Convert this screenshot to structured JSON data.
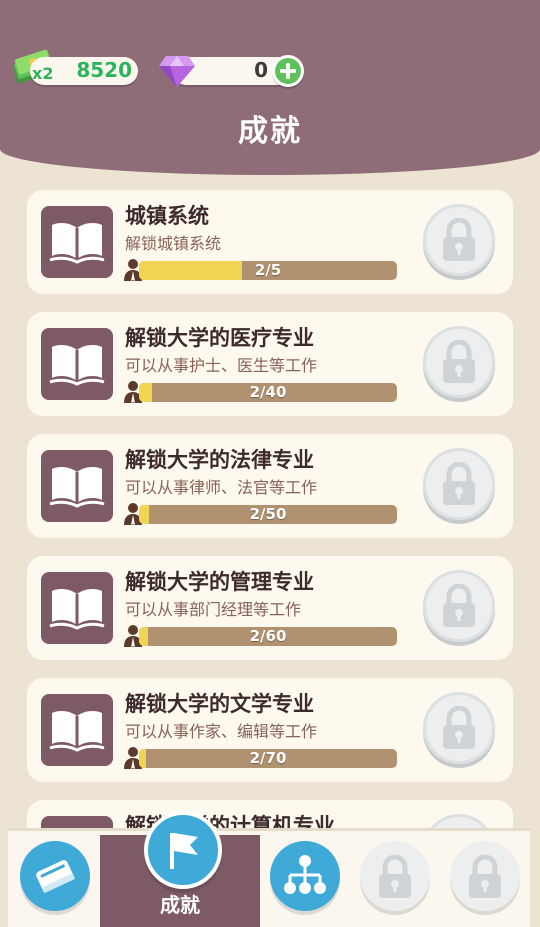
{
  "header": {
    "title": "成就",
    "cash": {
      "multiplier": "x2",
      "value": "8520"
    },
    "gems": {
      "value": "0"
    }
  },
  "achievements": [
    {
      "title": "城镇系统",
      "subtitle": "解锁城镇系统",
      "progress_text": "2/5",
      "current": 2,
      "target": 5
    },
    {
      "title": "解锁大学的医疗专业",
      "subtitle": "可以从事护士、医生等工作",
      "progress_text": "2/40",
      "current": 2,
      "target": 40
    },
    {
      "title": "解锁大学的法律专业",
      "subtitle": "可以从事律师、法官等工作",
      "progress_text": "2/50",
      "current": 2,
      "target": 50
    },
    {
      "title": "解锁大学的管理专业",
      "subtitle": "可以从事部门经理等工作",
      "progress_text": "2/60",
      "current": 2,
      "target": 60
    },
    {
      "title": "解锁大学的文学专业",
      "subtitle": "可以从事作家、编辑等工作",
      "progress_text": "2/70",
      "current": 2,
      "target": 70
    },
    {
      "title": "解锁大学的计算机专业",
      "subtitle": "",
      "progress_text": "",
      "current": 0,
      "target": 0
    }
  ],
  "bottom_nav": {
    "active_label": "成就",
    "items": [
      "book-icon",
      "flag-icon",
      "tree-icon",
      "lock-icon",
      "lock-icon"
    ]
  },
  "colors": {
    "header": "#8e6c78",
    "background": "#ece3d2",
    "card": "#fdf9ef",
    "tile": "#7d5a66",
    "bar_track": "#b09270",
    "bar_fill": "#f1d452",
    "cash_green": "#2fb35a"
  }
}
